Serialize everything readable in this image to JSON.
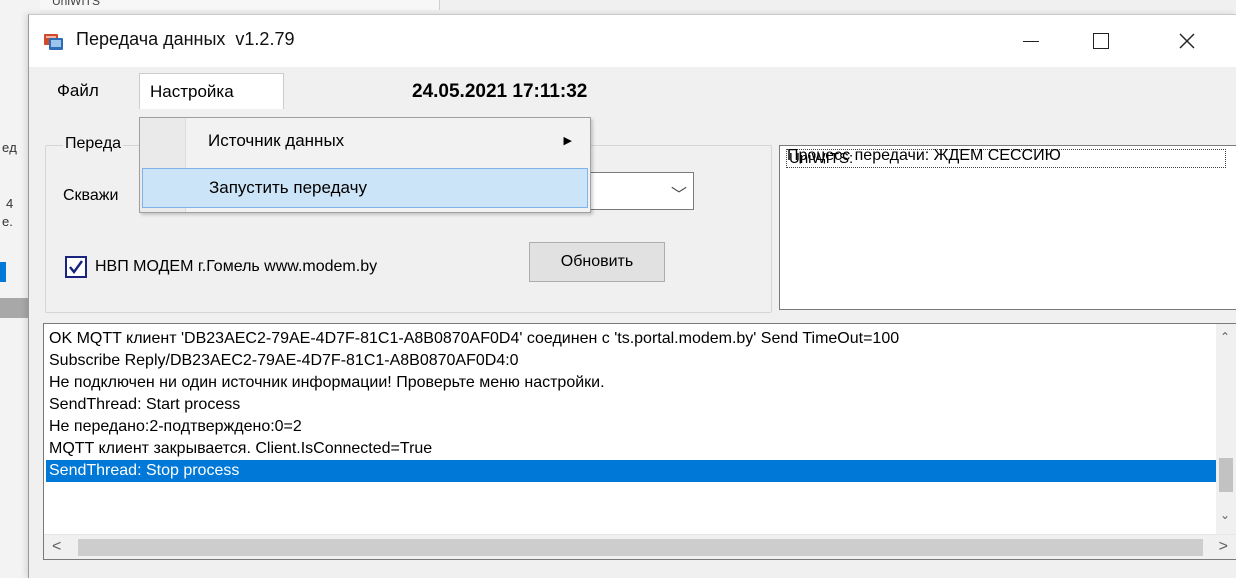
{
  "background": {
    "top_text": "UniWITS",
    "fragments": [
      "eд",
      "4",
      "e."
    ]
  },
  "window": {
    "title": "Передача данных  v1.2.79",
    "icons": {
      "app": "data-transfer-app-icon",
      "minimize": "minimize-icon",
      "maximize": "maximize-icon",
      "close": "close-icon"
    }
  },
  "menubar": {
    "file": "Файл",
    "settings": "Настройка",
    "datetime": "24.05.2021 17:11:32"
  },
  "settings_menu": {
    "items": [
      {
        "label": "Источник данных",
        "submenu_arrow": "▶"
      },
      {
        "label": "Запустить передачу"
      }
    ]
  },
  "transfer_group": {
    "label": "Переда",
    "well_label": "Скважи",
    "combo_value": "",
    "combo_arrow": "﹀",
    "checkbox_checked": true,
    "company_label": "НВП МОДЕМ г.Гомель www.modem.by",
    "refresh_button": "Обновить"
  },
  "process": {
    "label": "Процесс передачи: ЖДЕМ СЕССИЮ",
    "items": [
      "UniWITS:"
    ]
  },
  "log": {
    "lines": [
      "OK MQTT клиент 'DB23AEC2-79AE-4D7F-81C1-A8B0870AF0D4' соединен с 'ts.portal.modem.by' Send TimeOut=100",
      "Subscribe Reply/DB23AEC2-79AE-4D7F-81C1-A8B0870AF0D4:0",
      "Не подключен ни один источник информации! Проверьте меню настройки.",
      "SendThread: Start process",
      "Не передано:2-подтверждено:0=2",
      "MQTT клиент закрывается. Client.IsConnected=True",
      "SendThread: Stop process"
    ],
    "selected_index": 6,
    "scroll": {
      "up": "⌃",
      "down": "⌄",
      "left": "<",
      "right": ">"
    }
  },
  "colors": {
    "selection": "#0078d7",
    "menu_highlight": "#cce4f7",
    "checkbox": "#1a237e"
  }
}
